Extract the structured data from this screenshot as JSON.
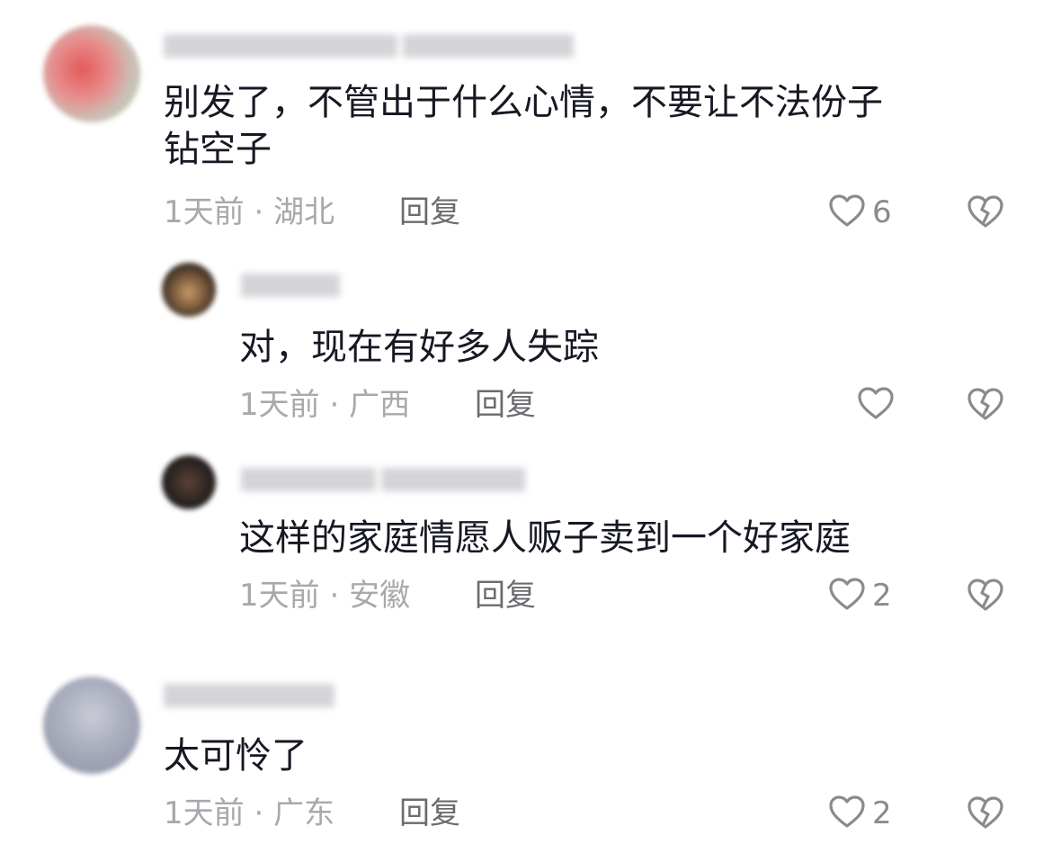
{
  "comments": [
    {
      "text_line1": "别发了，不管出于什么心情，不要让不法份子",
      "text_line2": "钻空子",
      "time": "1天前",
      "location": "湖北",
      "reply_label": "回复",
      "likes": "6",
      "replies": [
        {
          "text": "对，现在有好多人失踪",
          "time": "1天前",
          "location": "广西",
          "reply_label": "回复",
          "likes": ""
        },
        {
          "text": "这样的家庭情愿人贩子卖到一个好家庭",
          "time": "1天前",
          "location": "安徽",
          "reply_label": "回复",
          "likes": "2"
        }
      ]
    },
    {
      "text_line1": "太可怜了",
      "time": "1天前",
      "location": "广东",
      "reply_label": "回复",
      "likes": "2"
    }
  ],
  "meta_separator": "·",
  "colors": {
    "text": "#161823",
    "meta": "#a8a8ad",
    "reply": "#6b6b70",
    "icon": "#8a8a8f"
  }
}
